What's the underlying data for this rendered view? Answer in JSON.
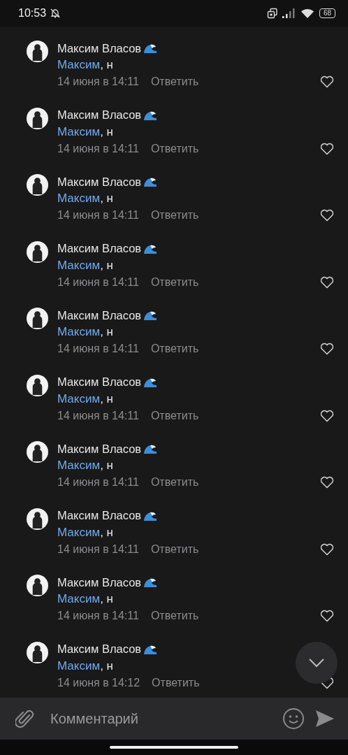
{
  "status_bar": {
    "time": "10:53",
    "battery": "68"
  },
  "comments": [
    {
      "author": "Максим Власов",
      "mention": "Максим",
      "text": ", н",
      "date": "14 июня в 14:11",
      "reply": "Ответить",
      "liked": false
    },
    {
      "author": "Максим Власов",
      "mention": "Максим",
      "text": ", н",
      "date": "14 июня в 14:11",
      "reply": "Ответить",
      "liked": false
    },
    {
      "author": "Максим Власов",
      "mention": "Максим",
      "text": ", н",
      "date": "14 июня в 14:11",
      "reply": "Ответить",
      "liked": false
    },
    {
      "author": "Максим Власов",
      "mention": "Максим",
      "text": ", н",
      "date": "14 июня в 14:11",
      "reply": "Ответить",
      "liked": false
    },
    {
      "author": "Максим Власов",
      "mention": "Максим",
      "text": ", н",
      "date": "14 июня в 14:11",
      "reply": "Ответить",
      "liked": false
    },
    {
      "author": "Максим Власов",
      "mention": "Максим",
      "text": ", н",
      "date": "14 июня в 14:11",
      "reply": "Ответить",
      "liked": false
    },
    {
      "author": "Максим Власов",
      "mention": "Максим",
      "text": ", н",
      "date": "14 июня в 14:11",
      "reply": "Ответить",
      "liked": false
    },
    {
      "author": "Максим Власов",
      "mention": "Максим",
      "text": ", н",
      "date": "14 июня в 14:11",
      "reply": "Ответить",
      "liked": false
    },
    {
      "author": "Максим Власов",
      "mention": "Максим",
      "text": ", н",
      "date": "14 июня в 14:11",
      "reply": "Ответить",
      "liked": false
    },
    {
      "author": "Максим Власов",
      "mention": "Максим",
      "text": ", н",
      "date": "14 июня в 14:12",
      "reply": "Ответить",
      "liked": false
    }
  ],
  "composer": {
    "placeholder": "Комментарий"
  }
}
